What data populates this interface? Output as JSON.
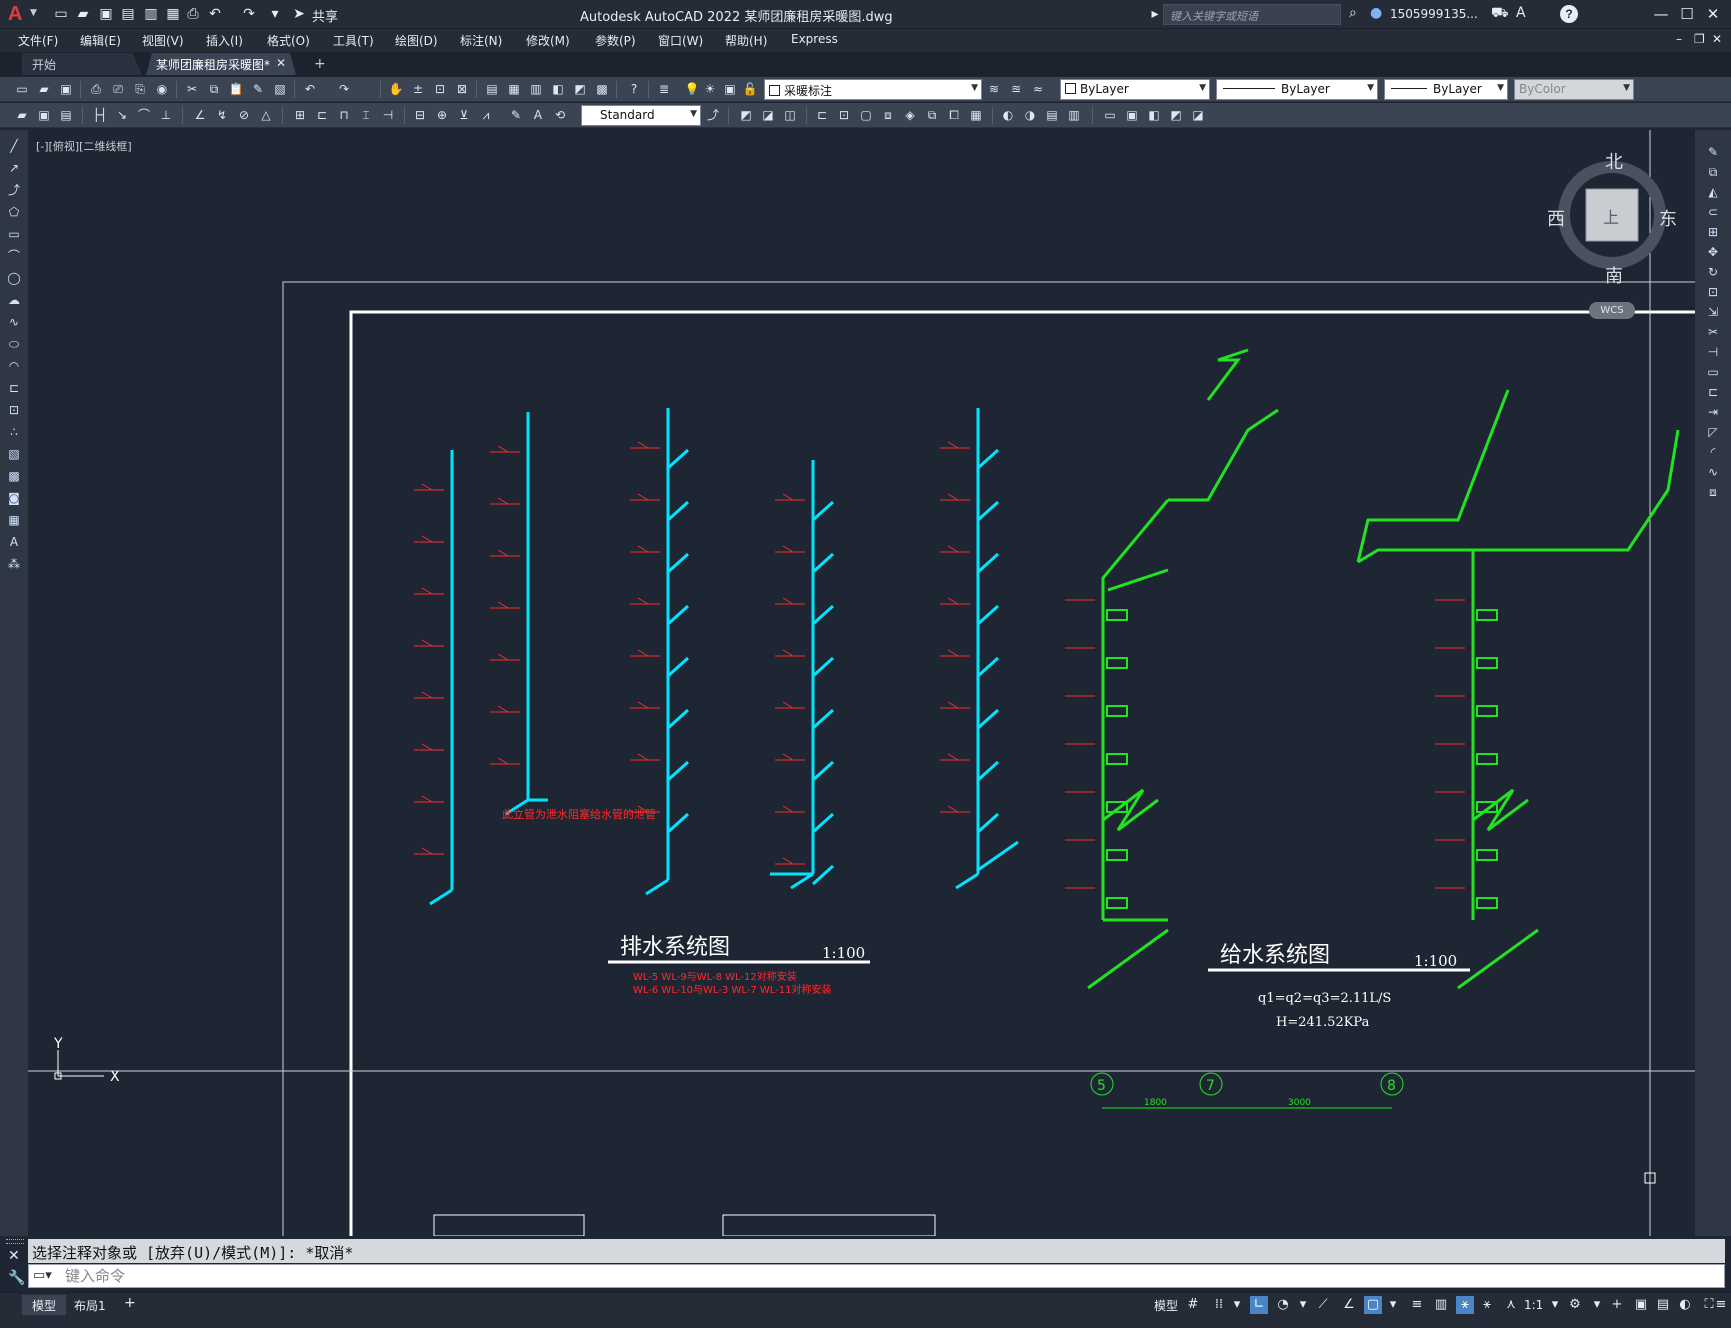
{
  "app": {
    "title": "Autodesk AutoCAD 2022    某师团廉租房采暖图.dwg",
    "share_label": "共享",
    "search_placeholder": "键入关键字或短语",
    "user_name": "1505999135...",
    "accent": "#e23d3d"
  },
  "menu": [
    "文件(F)",
    "编辑(E)",
    "视图(V)",
    "插入(I)",
    "格式(O)",
    "工具(T)",
    "绘图(D)",
    "标注(N)",
    "修改(M)",
    "参数(P)",
    "窗口(W)",
    "帮助(H)",
    "Express"
  ],
  "tabs": {
    "start": "开始",
    "drawing": "某师团廉租房采暖图*"
  },
  "toolbar": {
    "layer_combo": "采暖标注",
    "color_combo": "ByLayer",
    "linetype_combo": "ByLayer",
    "lineweight_combo": "ByLayer",
    "plotstyle_combo": "ByColor",
    "textstyle_combo": "Standard"
  },
  "viewport": {
    "label": "[-][俯视][二维线框]",
    "compass": {
      "north": "北",
      "south": "南",
      "east": "东",
      "west": "西",
      "top": "上"
    },
    "wcs": "WCS",
    "ucs_x": "X",
    "ucs_y": "Y"
  },
  "drawing": {
    "drainage_title": "排水系统图",
    "drainage_scale": "1:100",
    "drainage_note_1": "WL-5 WL-9与WL-8 WL-12对称安装",
    "drainage_note_2": "WL-6 WL-10与WL-3 WL-7 WL-11对称安装",
    "drainage_note_3": "此立管为泄水阻塞给水管的泄管",
    "water_title": "给水系统图",
    "water_scale": "1:100",
    "water_formula_1": "q1=q2=q3=2.11L/S",
    "water_formula_2": "H=241.52KPa",
    "axis_5": "5",
    "axis_7": "7",
    "axis_8": "8",
    "dim_1800": "1800",
    "dim_3000": "3000",
    "pipe_labels": [
      "WL-1",
      "WL-5",
      "WL-9",
      "De110",
      "WL-2",
      "WL-4",
      "WL-12",
      "De110",
      "WL-3",
      "De110",
      "WL-3",
      "WL-7",
      "WL-11",
      "De110",
      "JL1",
      "JL1"
    ],
    "colors": {
      "drainage": "#00e5ff",
      "water": "#22e322",
      "annotation": "#ff2a2a",
      "frame": "#ffffff",
      "axis": "#22e322"
    }
  },
  "command": {
    "history": "选择注释对象或 [放弃(U)/模式(M)]: *取消*",
    "placeholder": "键入命令"
  },
  "status": {
    "model_tab": "模型",
    "layout1_tab": "布局1",
    "model_space": "模型",
    "annotation_scale": "1:1"
  }
}
